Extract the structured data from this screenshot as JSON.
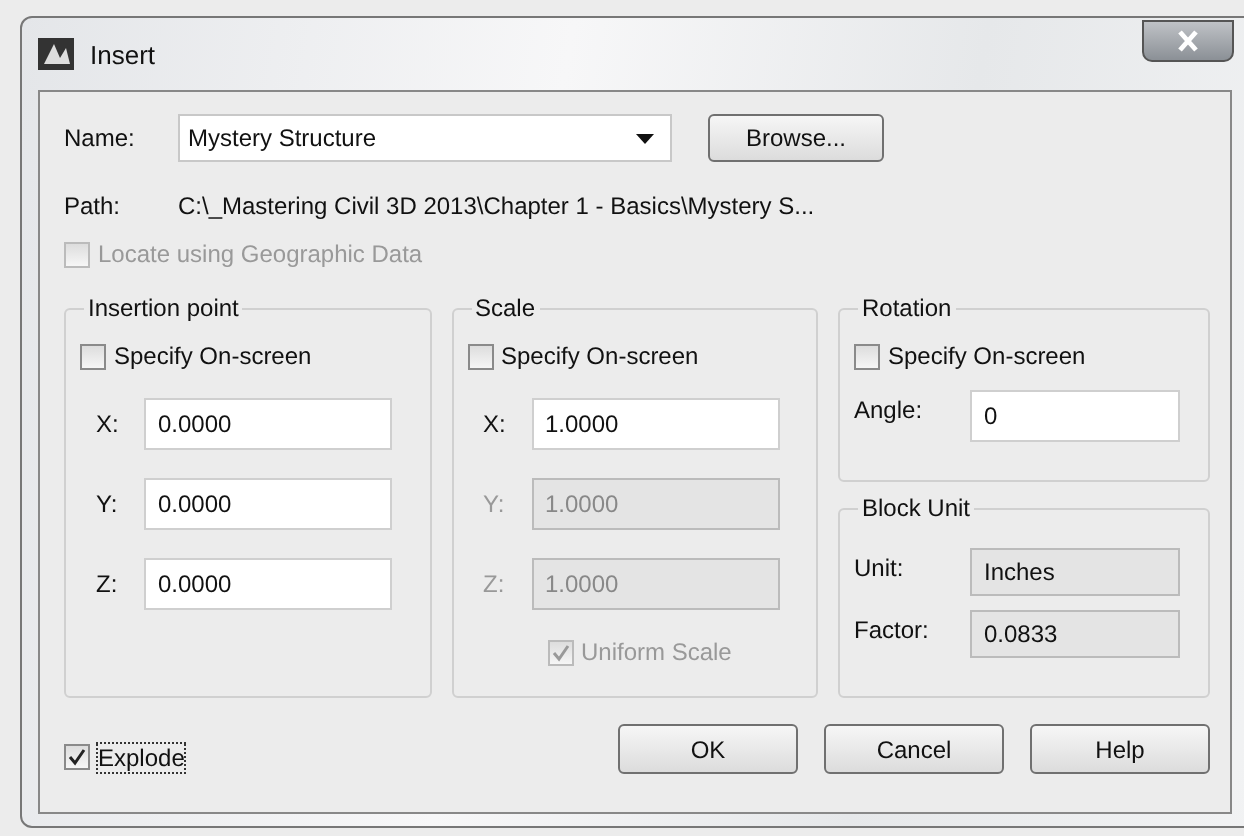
{
  "window": {
    "title": "Insert"
  },
  "name": {
    "label": "Name:",
    "value": "Mystery Structure"
  },
  "browse_button": "Browse...",
  "path": {
    "label": "Path:",
    "value": "C:\\_Mastering Civil 3D 2013\\Chapter 1 - Basics\\Mystery S..."
  },
  "locate_geographic": {
    "label": "Locate using Geographic Data",
    "checked": false,
    "disabled": true
  },
  "insertion_point": {
    "title": "Insertion point",
    "specify": {
      "label": "Specify On-screen",
      "checked": false
    },
    "fields": [
      {
        "label": "X:",
        "value": "0.0000",
        "disabled": false
      },
      {
        "label": "Y:",
        "value": "0.0000",
        "disabled": false
      },
      {
        "label": "Z:",
        "value": "0.0000",
        "disabled": false
      }
    ]
  },
  "scale": {
    "title": "Scale",
    "specify": {
      "label": "Specify On-screen",
      "checked": false
    },
    "fields": [
      {
        "label": "X:",
        "value": "1.0000",
        "disabled": false
      },
      {
        "label": "Y:",
        "value": "1.0000",
        "disabled": true
      },
      {
        "label": "Z:",
        "value": "1.0000",
        "disabled": true
      }
    ],
    "uniform": {
      "label": "Uniform Scale",
      "checked": true,
      "disabled": true
    }
  },
  "rotation": {
    "title": "Rotation",
    "specify": {
      "label": "Specify On-screen",
      "checked": false
    },
    "angle": {
      "label": "Angle:",
      "value": "0"
    }
  },
  "block_unit": {
    "title": "Block Unit",
    "rows": [
      {
        "label": "Unit:",
        "value": "Inches"
      },
      {
        "label": "Factor:",
        "value": "0.0833"
      }
    ]
  },
  "explode": {
    "label": "Explode",
    "checked": true
  },
  "buttons": [
    "OK",
    "Cancel",
    "Help"
  ]
}
